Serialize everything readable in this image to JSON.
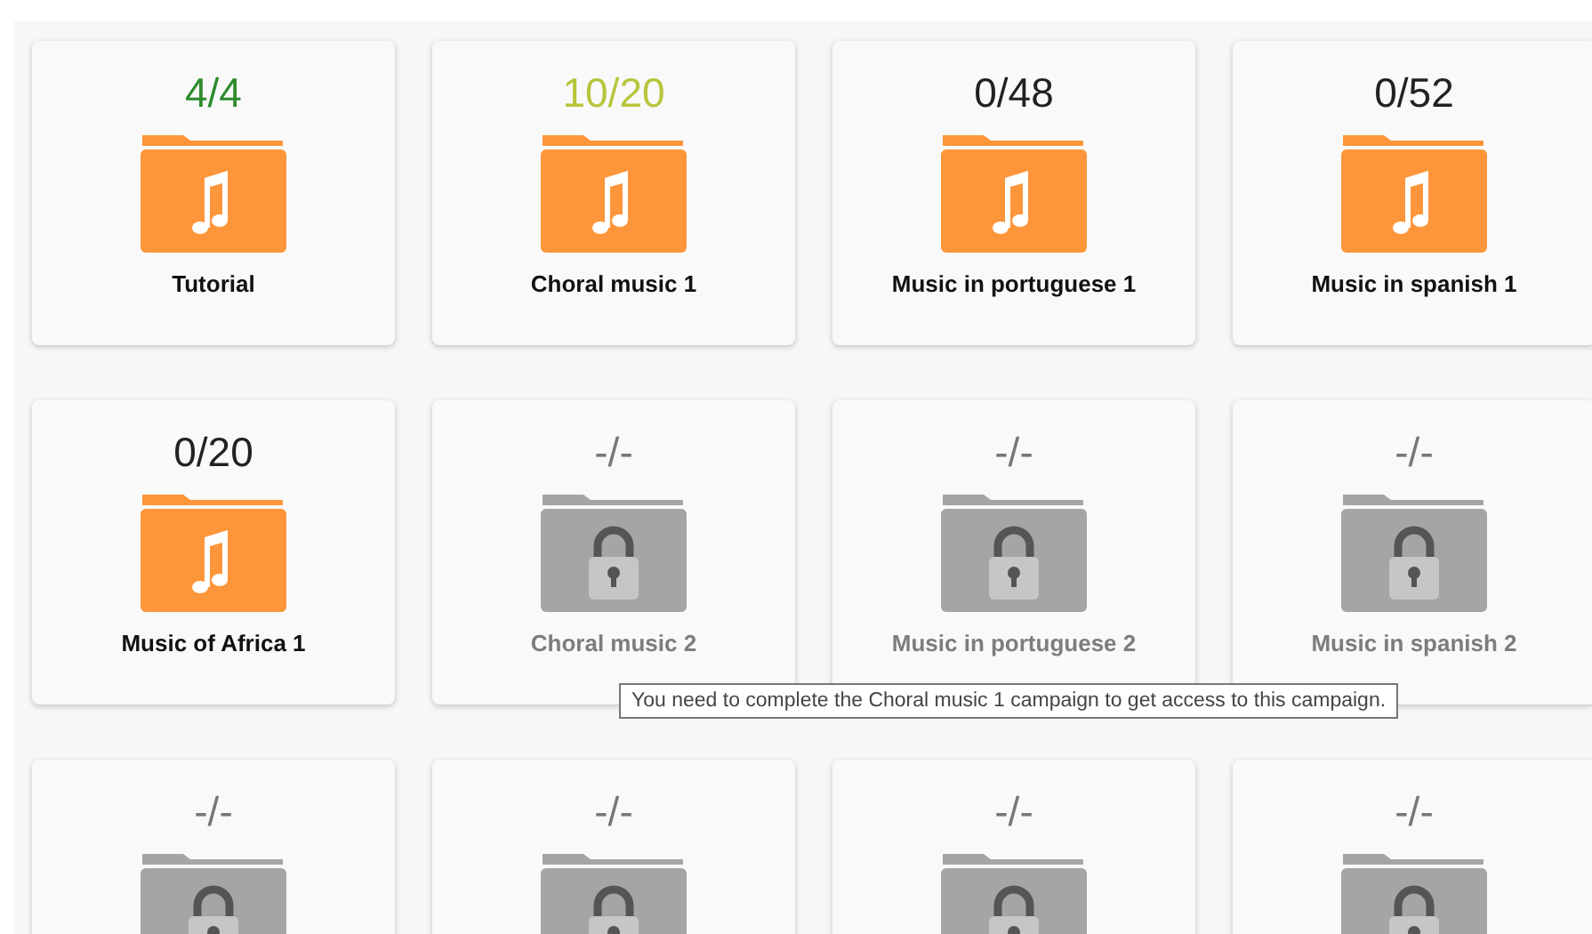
{
  "campaigns": [
    {
      "kind": "unlocked",
      "count": "4/4",
      "color": "#2e8b2e",
      "name": "Tutorial"
    },
    {
      "kind": "unlocked",
      "count": "10/20",
      "color": "#b7c53c",
      "name": "Choral music 1"
    },
    {
      "kind": "unlocked",
      "count": "0/48",
      "color": "#222222",
      "name": "Music in portuguese 1"
    },
    {
      "kind": "unlocked",
      "count": "0/52",
      "color": "#222222",
      "name": "Music in spanish 1"
    },
    {
      "kind": "unlocked",
      "count": "0/20",
      "color": "#222222",
      "name": "Music of Africa 1"
    },
    {
      "kind": "locked",
      "count": "-/-",
      "name": "Choral music 2"
    },
    {
      "kind": "locked",
      "count": "-/-",
      "name": "Music in portuguese 2"
    },
    {
      "kind": "locked",
      "count": "-/-",
      "name": "Music in spanish 2"
    },
    {
      "kind": "locked",
      "count": "-/-"
    },
    {
      "kind": "locked",
      "count": "-/-"
    },
    {
      "kind": "locked",
      "count": "-/-"
    },
    {
      "kind": "locked",
      "count": "-/-"
    }
  ],
  "tooltip": {
    "text": "You need to complete the Choral music 1 campaign to get access to this campaign."
  }
}
